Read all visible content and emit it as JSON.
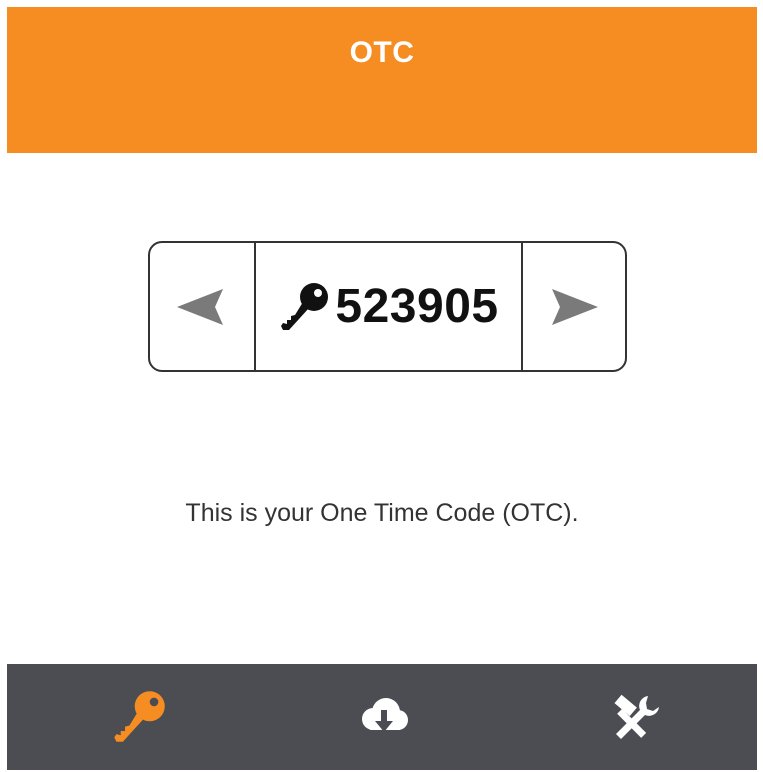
{
  "header": {
    "title": "OTC",
    "background_color": "#f68d23"
  },
  "otc": {
    "code": "523905",
    "prev_icon": "left-arrow-icon",
    "next_icon": "right-arrow-icon",
    "key_icon": "key-icon"
  },
  "message": {
    "text": "This is your One Time Code (OTC)."
  },
  "bottom_nav": {
    "background_color": "#4b4d52",
    "active_color": "#f68d23",
    "items": [
      {
        "icon": "key-icon",
        "active": true
      },
      {
        "icon": "cloud-download-icon",
        "active": false
      },
      {
        "icon": "tools-icon",
        "active": false
      }
    ]
  }
}
